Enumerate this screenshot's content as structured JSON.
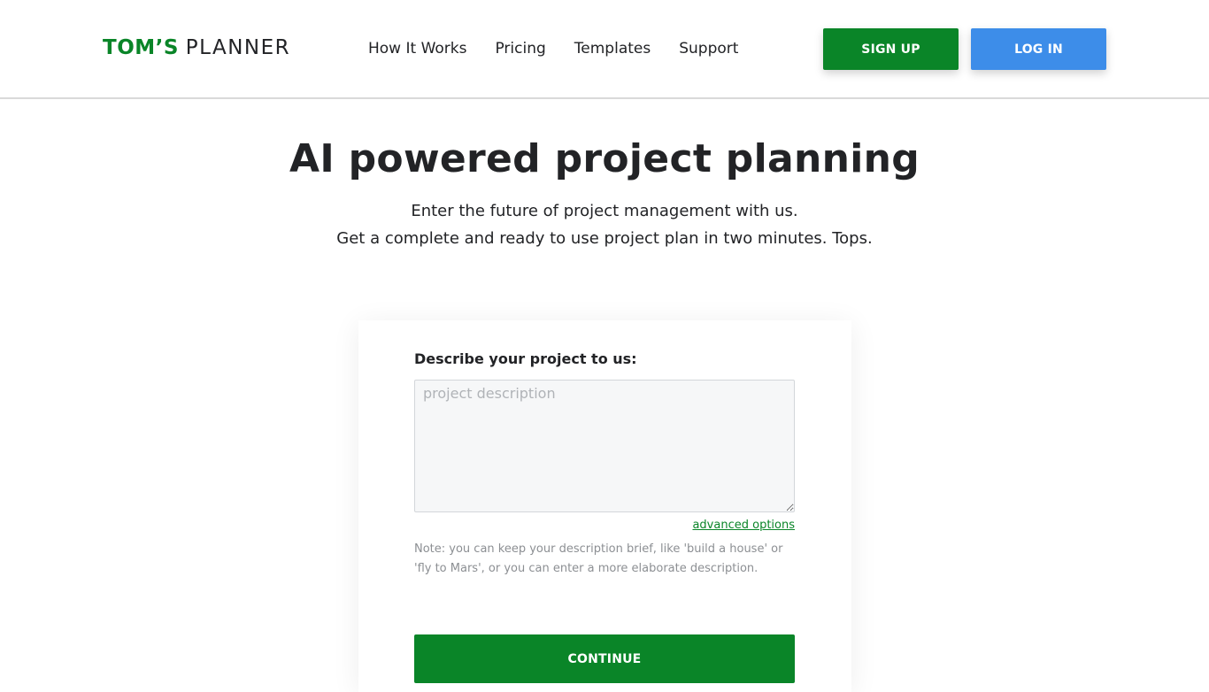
{
  "header": {
    "logo_bold": "TOM’S",
    "logo_light": "PLANNER",
    "nav": [
      {
        "label": "How It Works"
      },
      {
        "label": "Pricing"
      },
      {
        "label": "Templates"
      },
      {
        "label": "Support"
      }
    ],
    "signup_label": "SIGN UP",
    "login_label": "LOG IN"
  },
  "hero": {
    "title": "AI powered project planning",
    "subtitle_line1": "Enter the future of project management with us.",
    "subtitle_line2": "Get a complete and ready to use project plan in two minutes. Tops."
  },
  "form": {
    "label": "Describe your project to us:",
    "description_value": "",
    "description_placeholder": "project description",
    "advanced_options_label": "advanced options",
    "note": "Note: you can keep your description brief, like 'build a house' or 'fly to Mars', or you can enter a more elaborate description.",
    "continue_label": "CONTINUE"
  },
  "colors": {
    "brand_green": "#0a8528",
    "login_blue": "#3d8de9"
  }
}
